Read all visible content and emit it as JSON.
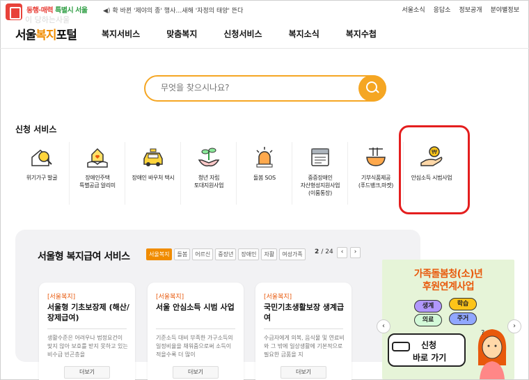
{
  "top": {
    "slogan_a": "동행·매력",
    "slogan_b": "특별시 서울",
    "watermark": "이 당하는사울",
    "notice": "확 바뀐 '제야의 종' 행사…새해 '자정의 태양' 뜬다",
    "links": [
      "서울소식",
      "응답소",
      "정보공개",
      "분야별정보"
    ]
  },
  "nav": {
    "brand_a": "서울",
    "brand_b": "복지",
    "brand_c": "포털",
    "menu": [
      "복지서비스",
      "맞춤복지",
      "신청서비스",
      "복지소식",
      "복지수첩"
    ]
  },
  "search": {
    "placeholder": "무엇을 찾으시나요?"
  },
  "services": {
    "title": "신청 서비스",
    "items": [
      {
        "line1": "위기가구 발굴",
        "line2": "",
        "line3": "",
        "icon": "house-search-icon"
      },
      {
        "line1": "장애인주택",
        "line2": "특별공급 알리미",
        "line3": "",
        "icon": "house-heart-icon"
      },
      {
        "line1": "장애인 바우처 택시",
        "line2": "",
        "line3": "",
        "icon": "taxi-icon"
      },
      {
        "line1": "청년 자립",
        "line2": "토대지원사업",
        "line3": "",
        "icon": "sprout-hands-icon"
      },
      {
        "line1": "돌봄 SOS",
        "line2": "",
        "line3": "",
        "icon": "siren-icon"
      },
      {
        "line1": "중증장애인",
        "line2": "자산형성지원사업",
        "line3": "(이룸통장)",
        "icon": "bankbook-icon"
      },
      {
        "line1": "기부식품제공",
        "line2": "(푸드뱅크,마켓)",
        "line3": "",
        "icon": "food-bowl-icon"
      },
      {
        "line1": "안심소득 시범사업",
        "line2": "",
        "line3": "",
        "icon": "coin-hand-icon"
      }
    ]
  },
  "welfare": {
    "title": "서울형 복지급여 서비스",
    "chips": [
      "서울복지",
      "돌봄",
      "어르신",
      "중장년",
      "장애인",
      "자활",
      "여성가족"
    ],
    "page_current": "2",
    "page_total": "/ 24",
    "prev": "‹",
    "next": "›",
    "cards": [
      {
        "tag": "[서울복지]",
        "title": "서울형 기초보장제 (해산/장제급여)",
        "desc": "생활수준은 어려우나 법정요건이 맞지 않아 보호를 받지 못하고 있는 비수급 빈곤층을",
        "more": "더보기"
      },
      {
        "tag": "[서울복지]",
        "title": "서울 안심소득 시범 사업",
        "desc": "기준소득 대비 부족한 가구소득의 일정비율을 채워줌으로써 소득이 적을수록 더 많이",
        "more": "더보기"
      },
      {
        "tag": "[서울복지]",
        "title": "국민기초생활보장 생계급여",
        "desc": "수급자에게 의복, 음식물 및 연료비와 그 밖에 일상생활에 기본적으로 필요한 금품을 지",
        "more": "더보기"
      }
    ]
  },
  "banner": {
    "title1": "가족돌봄청(소)년",
    "title2": "후원연계사업",
    "bubbles": [
      "생계",
      "학습",
      "의료",
      "주거"
    ],
    "cta1": "신청",
    "cta2": "바로 가기",
    "prev": "‹",
    "next": "›"
  }
}
